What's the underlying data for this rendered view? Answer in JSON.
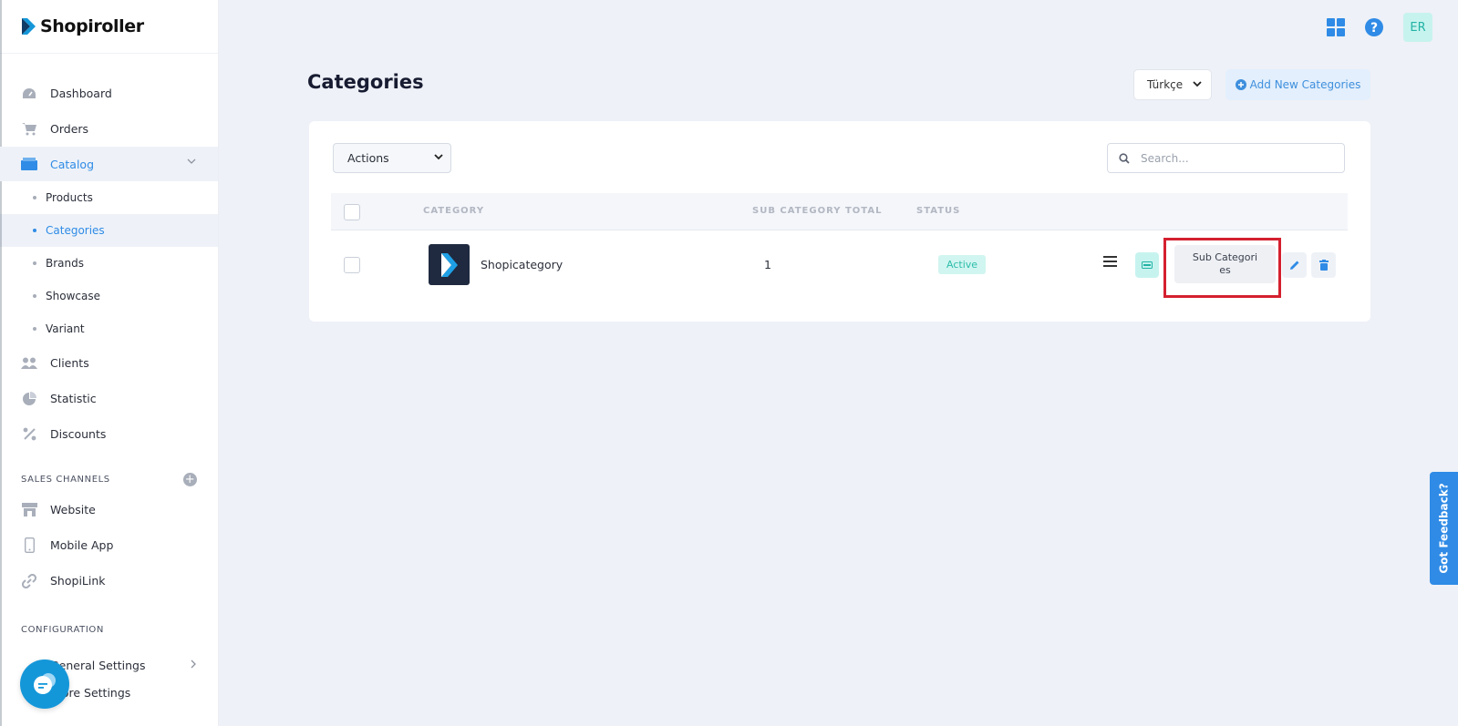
{
  "brand": {
    "name": "Shopiroller"
  },
  "sidebar": {
    "items": [
      {
        "label": "Dashboard",
        "icon": "gauge-icon"
      },
      {
        "label": "Orders",
        "icon": "cart-icon"
      },
      {
        "label": "Catalog",
        "icon": "box-icon",
        "active": true
      },
      {
        "label": "Products",
        "sub": true
      },
      {
        "label": "Categories",
        "sub": true,
        "active": true
      },
      {
        "label": "Brands",
        "sub": true
      },
      {
        "label": "Showcase",
        "sub": true
      },
      {
        "label": "Variant",
        "sub": true
      },
      {
        "label": "Clients",
        "icon": "users-icon"
      },
      {
        "label": "Statistic",
        "icon": "pie-chart-icon"
      },
      {
        "label": "Discounts",
        "icon": "percent-icon"
      }
    ],
    "sales_channels_label": "SALES CHANNELS",
    "sales_channels": [
      {
        "label": "Website",
        "icon": "store-icon"
      },
      {
        "label": "Mobile App",
        "icon": "mobile-icon"
      },
      {
        "label": "ShopiLink",
        "icon": "link-icon"
      }
    ],
    "configuration_label": "CONFIGURATION",
    "configuration": [
      {
        "label": "General Settings"
      },
      {
        "label": "Store Settings"
      }
    ]
  },
  "header": {
    "avatar_initials": "ER"
  },
  "page": {
    "title": "Categories",
    "language": "Türkçe",
    "add_button": "Add New Categories"
  },
  "toolbar": {
    "actions_label": "Actions",
    "search_placeholder": "Search..."
  },
  "table": {
    "columns": [
      "CATEGORY",
      "SUB CATEGORY TOTAL",
      "STATUS"
    ],
    "rows": [
      {
        "name": "Shopicategory",
        "sub_total": "1",
        "status": "Active",
        "sub_button": "Sub Categori es"
      }
    ]
  },
  "feedback": {
    "label": "Got Feedback?"
  },
  "colors": {
    "accent": "#2f8be6",
    "active_badge": "#2cbdab",
    "highlight": "#d4202f"
  }
}
